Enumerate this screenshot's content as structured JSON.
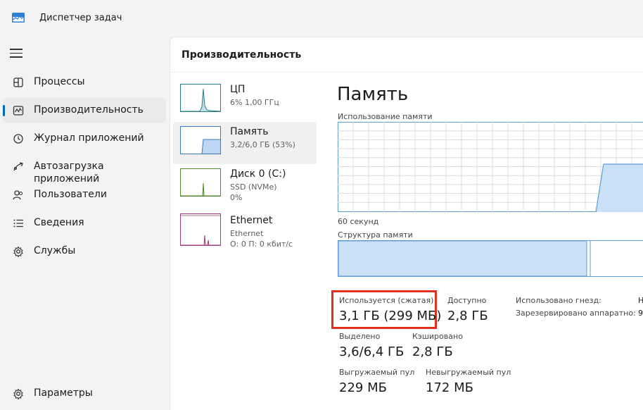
{
  "window": {
    "title": "Диспетчер задач",
    "app_icon": "task-manager-icon"
  },
  "nav": {
    "items": [
      {
        "label": "Процессы",
        "icon": "processes-icon"
      },
      {
        "label": "Производительность",
        "icon": "performance-icon",
        "active": true
      },
      {
        "label": "Журнал приложений",
        "icon": "app-history-icon"
      },
      {
        "label": "Автозагрузка приложений",
        "icon": "startup-apps-icon"
      },
      {
        "label": "Пользователи",
        "icon": "users-icon"
      },
      {
        "label": "Сведения",
        "icon": "details-icon"
      },
      {
        "label": "Службы",
        "icon": "services-icon"
      }
    ],
    "settings_label": "Параметры"
  },
  "content": {
    "header": "Производительность",
    "perf_items": [
      {
        "title": "ЦП",
        "sub1": "6%  1,00 ГГц",
        "sub2": ""
      },
      {
        "title": "Память",
        "sub1": "3,2/6,0 ГБ (53%)",
        "sub2": ""
      },
      {
        "title": "Диск 0 (C:)",
        "sub1": "SSD (NVMe)",
        "sub2": "0%"
      },
      {
        "title": "Ethernet",
        "sub1": "Ethernet",
        "sub2": "О: 0 П: 0 кбит/с"
      }
    ]
  },
  "memory": {
    "title": "Память",
    "usage_label": "Использование памяти",
    "time_label": "60 секунд",
    "structure_label": "Структура памяти",
    "stats": {
      "in_use_label": "Используется (сжатая)",
      "in_use_value": "3,1 ГБ (299 МБ)",
      "available_label": "Доступно",
      "available_value": "2,8 ГБ",
      "committed_label": "Выделено",
      "committed_value": "3,6/6,4 ГБ",
      "cached_label": "Кэшировано",
      "cached_value": "2,8 ГБ",
      "paged_label": "Выгружаемый пул",
      "paged_value": "229 МБ",
      "nonpaged_label": "Невыгружаемый пул",
      "nonpaged_value": "172 МБ",
      "slots_label": "Использовано гнезд:",
      "slots_value": "Н",
      "reserved_label": "Зарезервировано аппаратно:",
      "reserved_value": "9,"
    },
    "in_use_fraction": 0.53,
    "colors": {
      "accent": "#0067c0",
      "memory_fill": "#c9e0f7",
      "memory_line": "#5e9bd8",
      "highlight": "#e0301e"
    }
  }
}
